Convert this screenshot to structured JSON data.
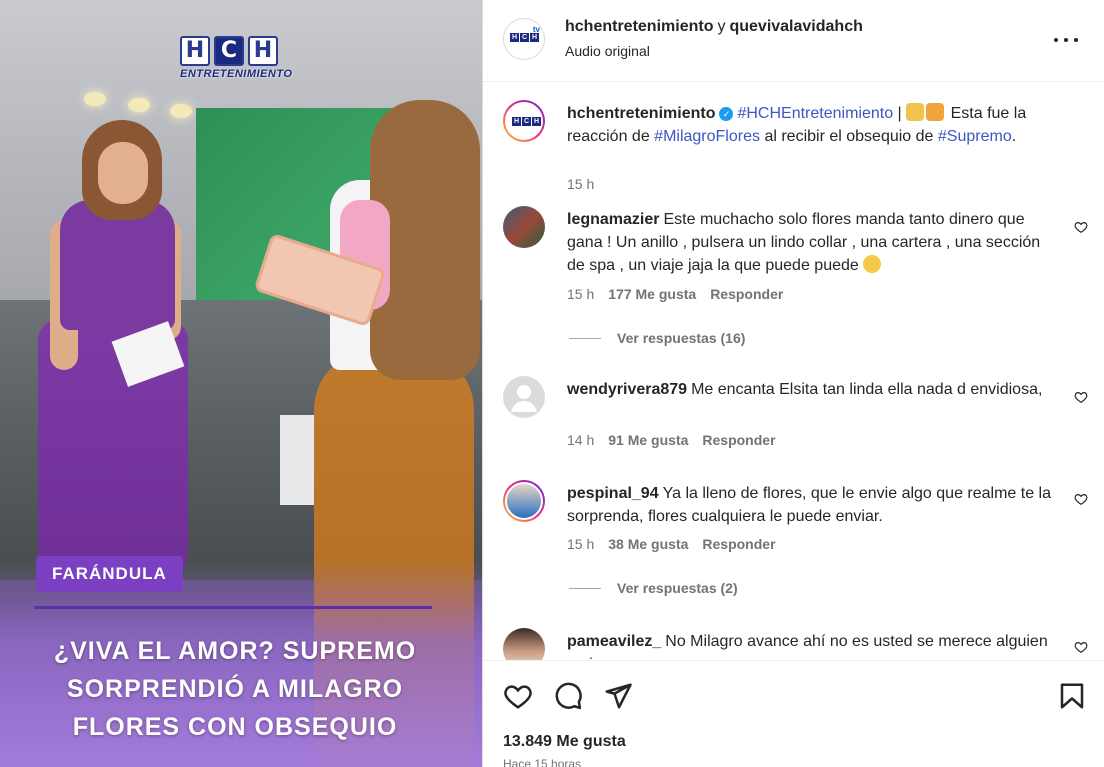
{
  "media": {
    "logo_letters": [
      "H",
      "C",
      "H"
    ],
    "logo_subtitle": "ENTRETENIMIENTO",
    "tag": "FARÁNDULA",
    "headline": "¿VIVA EL AMOR? SUPREMO SORPRENDIÓ A MILAGRO FLORES CON OBSEQUIO",
    "accent_color": "#7b3fc2"
  },
  "header": {
    "user1": "hchentretenimiento",
    "joiner": "y",
    "user2": "quevivalavidahch",
    "audio": "Audio original",
    "more_icon": "more-horizontal-icon"
  },
  "caption": {
    "user": "hchentretenimiento",
    "hashtag1": "#HCHEntretenimiento",
    "separator": "|",
    "text1": "Esta fue la reacción de",
    "hashtag2": "#MilagroFlores",
    "text2": "al recibir el obsequio de",
    "hashtag3": "#Supremo",
    "text3": ".",
    "time": "15 h"
  },
  "comments": [
    {
      "user": "legnamazier",
      "text": "Este muchacho solo flores manda tanto dinero que gana ! Un anillo , pulsera un lindo collar , una cartera , una sección de spa , un viaje jaja la que puede puede",
      "time": "15 h",
      "likes": "177 Me gusta",
      "reply": "Responder",
      "view_replies": "Ver respuestas (16)"
    },
    {
      "user": "wendyrivera879",
      "text": "Me encanta Elsita tan linda ella nada d envidiosa,",
      "time": "14 h",
      "likes": "91 Me gusta",
      "reply": "Responder"
    },
    {
      "user": "pespinal_94",
      "text": "Ya la lleno de flores, que le envie algo que realme te la sorprenda, flores cualquiera le puede enviar.",
      "time": "15 h",
      "likes": "38 Me gusta",
      "reply": "Responder",
      "view_replies": "Ver respuestas (2)"
    },
    {
      "user": "pameavilez_",
      "text": "No Milagro avance ahí no es usted se merece alguien mejor"
    }
  ],
  "footer": {
    "likes_total": "13.849 Me gusta",
    "time_ago": "Hace 15 horas"
  }
}
